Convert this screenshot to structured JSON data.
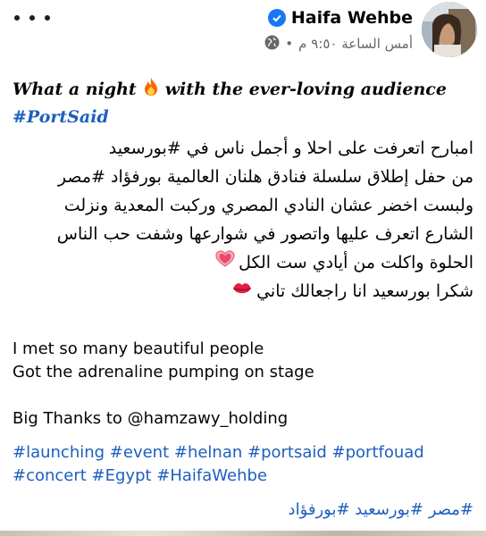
{
  "post": {
    "author_name": "Haifa Wehbe",
    "timestamp": "أمس الساعة ٩:٥٠ م",
    "separator": "•",
    "icons": {
      "verified": "verified-badge-icon",
      "audience": "globe-icon",
      "more": "more-options-icon"
    },
    "title": {
      "before_emoji": "What a night",
      "emoji": "fire-emoji",
      "after_emoji": "with the ever-loving audience",
      "hashtag": "#PortSaid"
    },
    "arabic_lines": [
      "امبارح اتعرفت على احلا و أجمل ناس في #بورسعيد",
      "من حفل إطلاق سلسلة فنادق هلنان العالمية بورفؤاد #مصر",
      "ولبست اخضر عشان  النادي المصري وركبت المعدية ونزلت",
      "الشارع اتعرف عليها واتصور في شوارعها وشفت حب الناس",
      "الحلوة  واكلت من أيادي ست الكل",
      "شكرا بورسعيد انا راجعالك تاني"
    ],
    "english_lines": [
      "I met so many beautiful people",
      "Got the adrenaline pumping on stage",
      "",
      "Big Thanks to @hamzawy_holding"
    ],
    "hashtag_lines": [
      "#launching #event #helnan #portsaid #portfouad",
      "#concert #Egypt #HaifaWehbe"
    ],
    "arabic_hashtags": "#مصر #بورسعيد #بورفؤاد",
    "colors": {
      "hashtag": "#1d5fbf",
      "verified": "#1877f2",
      "meta": "#65676b"
    }
  }
}
